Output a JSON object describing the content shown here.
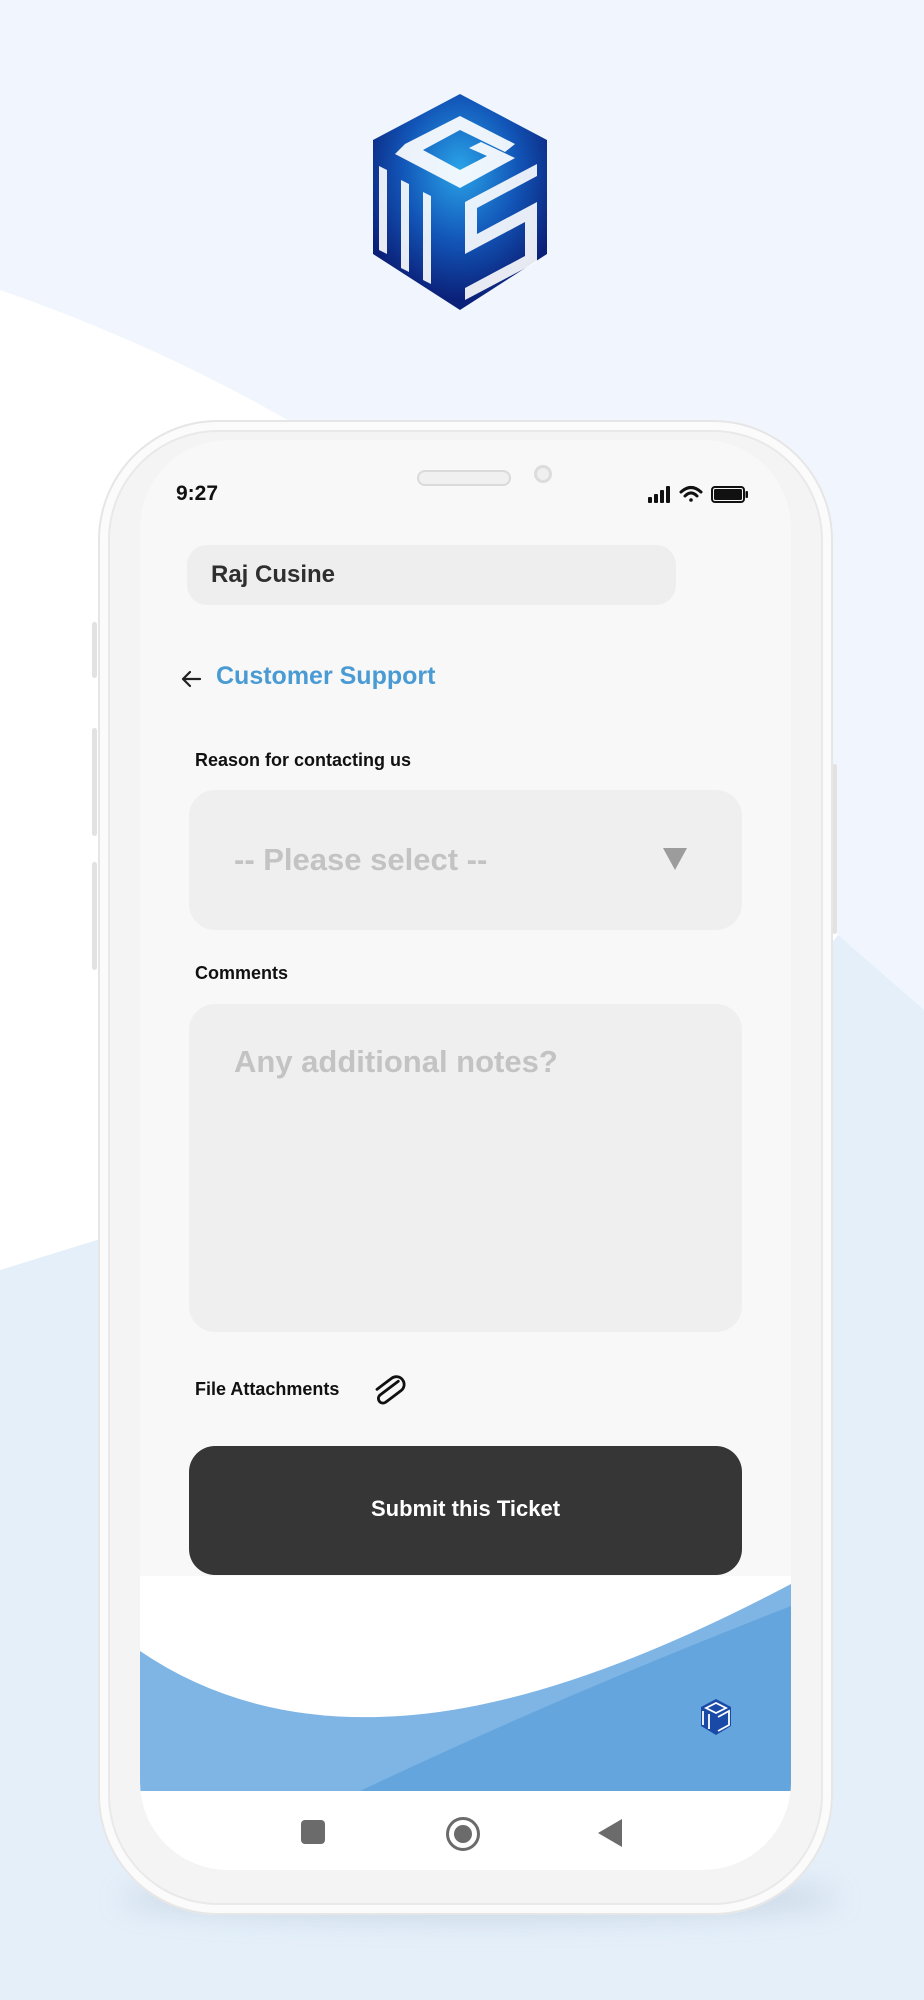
{
  "status_bar": {
    "time": "9:27"
  },
  "header": {
    "user_name": "Raj Cusine"
  },
  "page": {
    "title": "Customer Support"
  },
  "form": {
    "reason_label": "Reason  for contacting us",
    "reason_placeholder": "-- Please select --",
    "comments_label": "Comments",
    "comments_placeholder": "Any additional notes?",
    "attachments_label": "File Attachments",
    "submit_label": "Submit this Ticket"
  },
  "icons": {
    "back": "arrow-left-icon",
    "caret": "triangle-down-icon",
    "attachment": "paperclip-icon",
    "signal": "signal-icon",
    "wifi": "wifi-icon",
    "battery": "battery-icon",
    "nav_recents": "square-icon",
    "nav_home": "circle-icon",
    "nav_back": "triangle-left-icon"
  },
  "colors": {
    "accent": "#4a9bd3",
    "brand_dark": "#0d2e86",
    "submit_bg": "#363636",
    "wave_blue": "#6aaae0"
  }
}
